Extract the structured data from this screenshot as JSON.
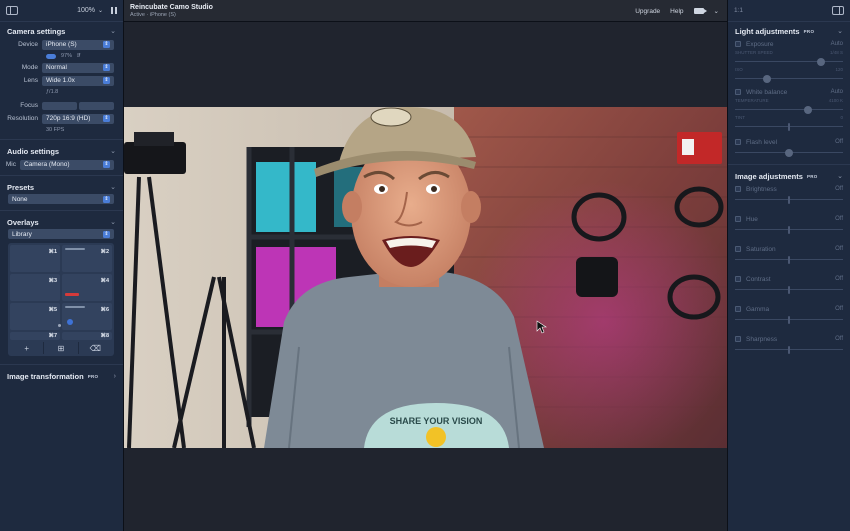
{
  "left": {
    "zoom": "100%",
    "camera": {
      "title": "Camera settings",
      "device_label": "Device",
      "device": "iPhone (S)",
      "battery": "97%",
      "mode_label": "Mode",
      "mode": "Normal",
      "lens_label": "Lens",
      "lens": "Wide 1.0x",
      "aperture": "ƒ/1.8",
      "focus_label": "Focus",
      "resolution_label": "Resolution",
      "resolution": "720p 16:9 (HD)",
      "fps": "30 FPS"
    },
    "audio": {
      "title": "Audio settings",
      "mic_label": "Mic",
      "mic": "Camera (Mono)"
    },
    "presets": {
      "title": "Presets",
      "value": "None"
    },
    "overlays": {
      "title": "Overlays",
      "source": "Library",
      "cells": [
        "⌘1",
        "⌘2",
        "⌘3",
        "⌘4",
        "⌘5",
        "⌘6",
        "⌘7",
        "⌘8"
      ]
    },
    "image_transformation": {
      "title": "Image transformation",
      "pro": "PRO"
    }
  },
  "topbar": {
    "app_title": "Reincubate Camo Studio",
    "status": "Active · iPhone (S)",
    "upgrade": "Upgrade",
    "help": "Help"
  },
  "right": {
    "ratio": "1:1",
    "light": {
      "title": "Light adjustments",
      "pro": "PRO",
      "exposure": {
        "name": "Exposure",
        "value": "Auto",
        "sub_left": "SHUTTER SPEED",
        "sub_right": "1/48 S",
        "sub2_left": "ISO",
        "sub2_right": "120",
        "knob1": 0.8,
        "knob2": 0.3
      },
      "white_balance": {
        "name": "White balance",
        "value": "Auto",
        "sub_left": "TEMPERATURE",
        "sub_right": "4100 K",
        "sub2_left": "TINT",
        "sub2_right": "0",
        "knob1": 0.68,
        "knob2": 0.5
      },
      "flash": {
        "name": "Flash level",
        "value": "Off",
        "knob": 0.5
      }
    },
    "image": {
      "title": "Image adjustments",
      "pro": "PRO",
      "items": [
        {
          "name": "Brightness",
          "value": "Off"
        },
        {
          "name": "Hue",
          "value": "Off"
        },
        {
          "name": "Saturation",
          "value": "Off"
        },
        {
          "name": "Contrast",
          "value": "Off"
        },
        {
          "name": "Gamma",
          "value": "Off"
        },
        {
          "name": "Sharpness",
          "value": "Off"
        }
      ]
    }
  },
  "video": {
    "shirt_text": "SHARE YOUR VISION"
  },
  "colors": {
    "accent": "#4a7dd8",
    "panel": "#1e2a3f",
    "stage": "#20242e"
  }
}
